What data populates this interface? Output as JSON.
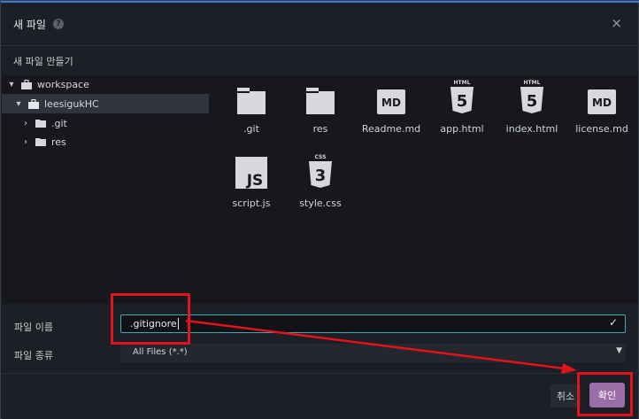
{
  "dialog": {
    "title": "새 파일",
    "help_icon": "?",
    "close_icon": "×",
    "subtitle": "새 파일 만들기"
  },
  "tree": {
    "items": [
      {
        "label": "workspace",
        "expanded": true,
        "icon": "briefcase-icon"
      },
      {
        "label": "leesigukHC",
        "expanded": true,
        "icon": "briefcase-icon",
        "selected": true
      },
      {
        "label": ".git",
        "expanded": false,
        "icon": "folder-icon"
      },
      {
        "label": "res",
        "expanded": false,
        "icon": "folder-icon"
      }
    ]
  },
  "files": [
    {
      "name": ".git",
      "icon": "folder-icon"
    },
    {
      "name": "res",
      "icon": "folder-icon"
    },
    {
      "name": "Readme.md",
      "icon": "md-icon",
      "badge": "MD"
    },
    {
      "name": "app.html",
      "icon": "html5-icon",
      "badge": "HTML"
    },
    {
      "name": "index.html",
      "icon": "html5-icon",
      "badge": "HTML"
    },
    {
      "name": "license.md",
      "icon": "md-icon",
      "badge": "MD"
    },
    {
      "name": "script.js",
      "icon": "js-icon",
      "badge": "JS"
    },
    {
      "name": "style.css",
      "icon": "css3-icon",
      "badge": "CSS"
    }
  ],
  "form": {
    "filename_label": "파일 이름",
    "filename_value": ".gitignore",
    "filetype_label": "파일 종류",
    "filetype_value": "All Files (*.*)"
  },
  "buttons": {
    "cancel": "취소",
    "ok": "확인"
  },
  "colors": {
    "accent_border": "#3fa9b5",
    "ok_button": "#9b6ea9",
    "annotation_red": "#e0141a"
  }
}
